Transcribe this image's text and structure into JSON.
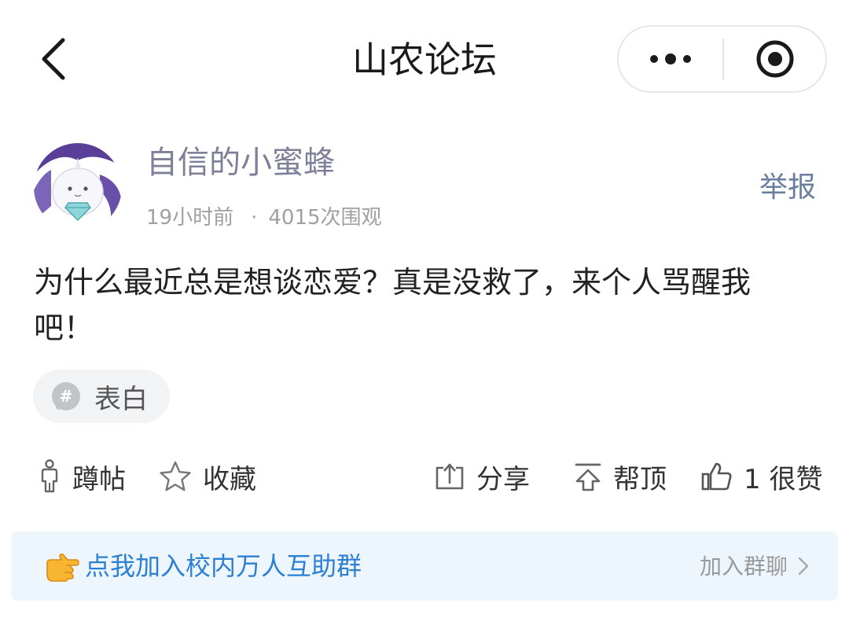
{
  "navbar": {
    "title": "山农论坛",
    "back_icon": "chevron-left-icon",
    "more_icon": "more-dots-icon",
    "close_icon": "target-close-icon"
  },
  "post": {
    "author": {
      "name": "自信的小蜜蜂",
      "avatar": "avatar-image"
    },
    "time": "19小时前",
    "separator": "·",
    "views": "4015次围观",
    "report_label": "举报",
    "content": "为什么最近总是想谈恋爱？真是没救了，来个人骂醒我吧！",
    "tag": {
      "icon": "hashtag-icon",
      "label": "表白"
    }
  },
  "actions": {
    "squat": {
      "icon": "person-icon",
      "label": "蹲帖"
    },
    "favorite": {
      "icon": "star-icon",
      "label": "收藏"
    },
    "share": {
      "icon": "share-icon",
      "label": "分享"
    },
    "top": {
      "icon": "pin-top-icon",
      "label": "帮顶"
    },
    "like": {
      "icon": "thumbs-up-icon",
      "count": "1",
      "label": "很赞"
    }
  },
  "banner": {
    "emoji": "pointing-hand-icon",
    "text": "点我加入校内万人互助群",
    "join_label": "加入群聊",
    "chevron": "chevron-right-icon"
  },
  "colors": {
    "author_name": "#7e7f99",
    "report": "#6c7ea0",
    "banner_text": "#2d7fd3",
    "banner_bg": "#eef6fd",
    "tag_bg": "#f2f3f5"
  }
}
